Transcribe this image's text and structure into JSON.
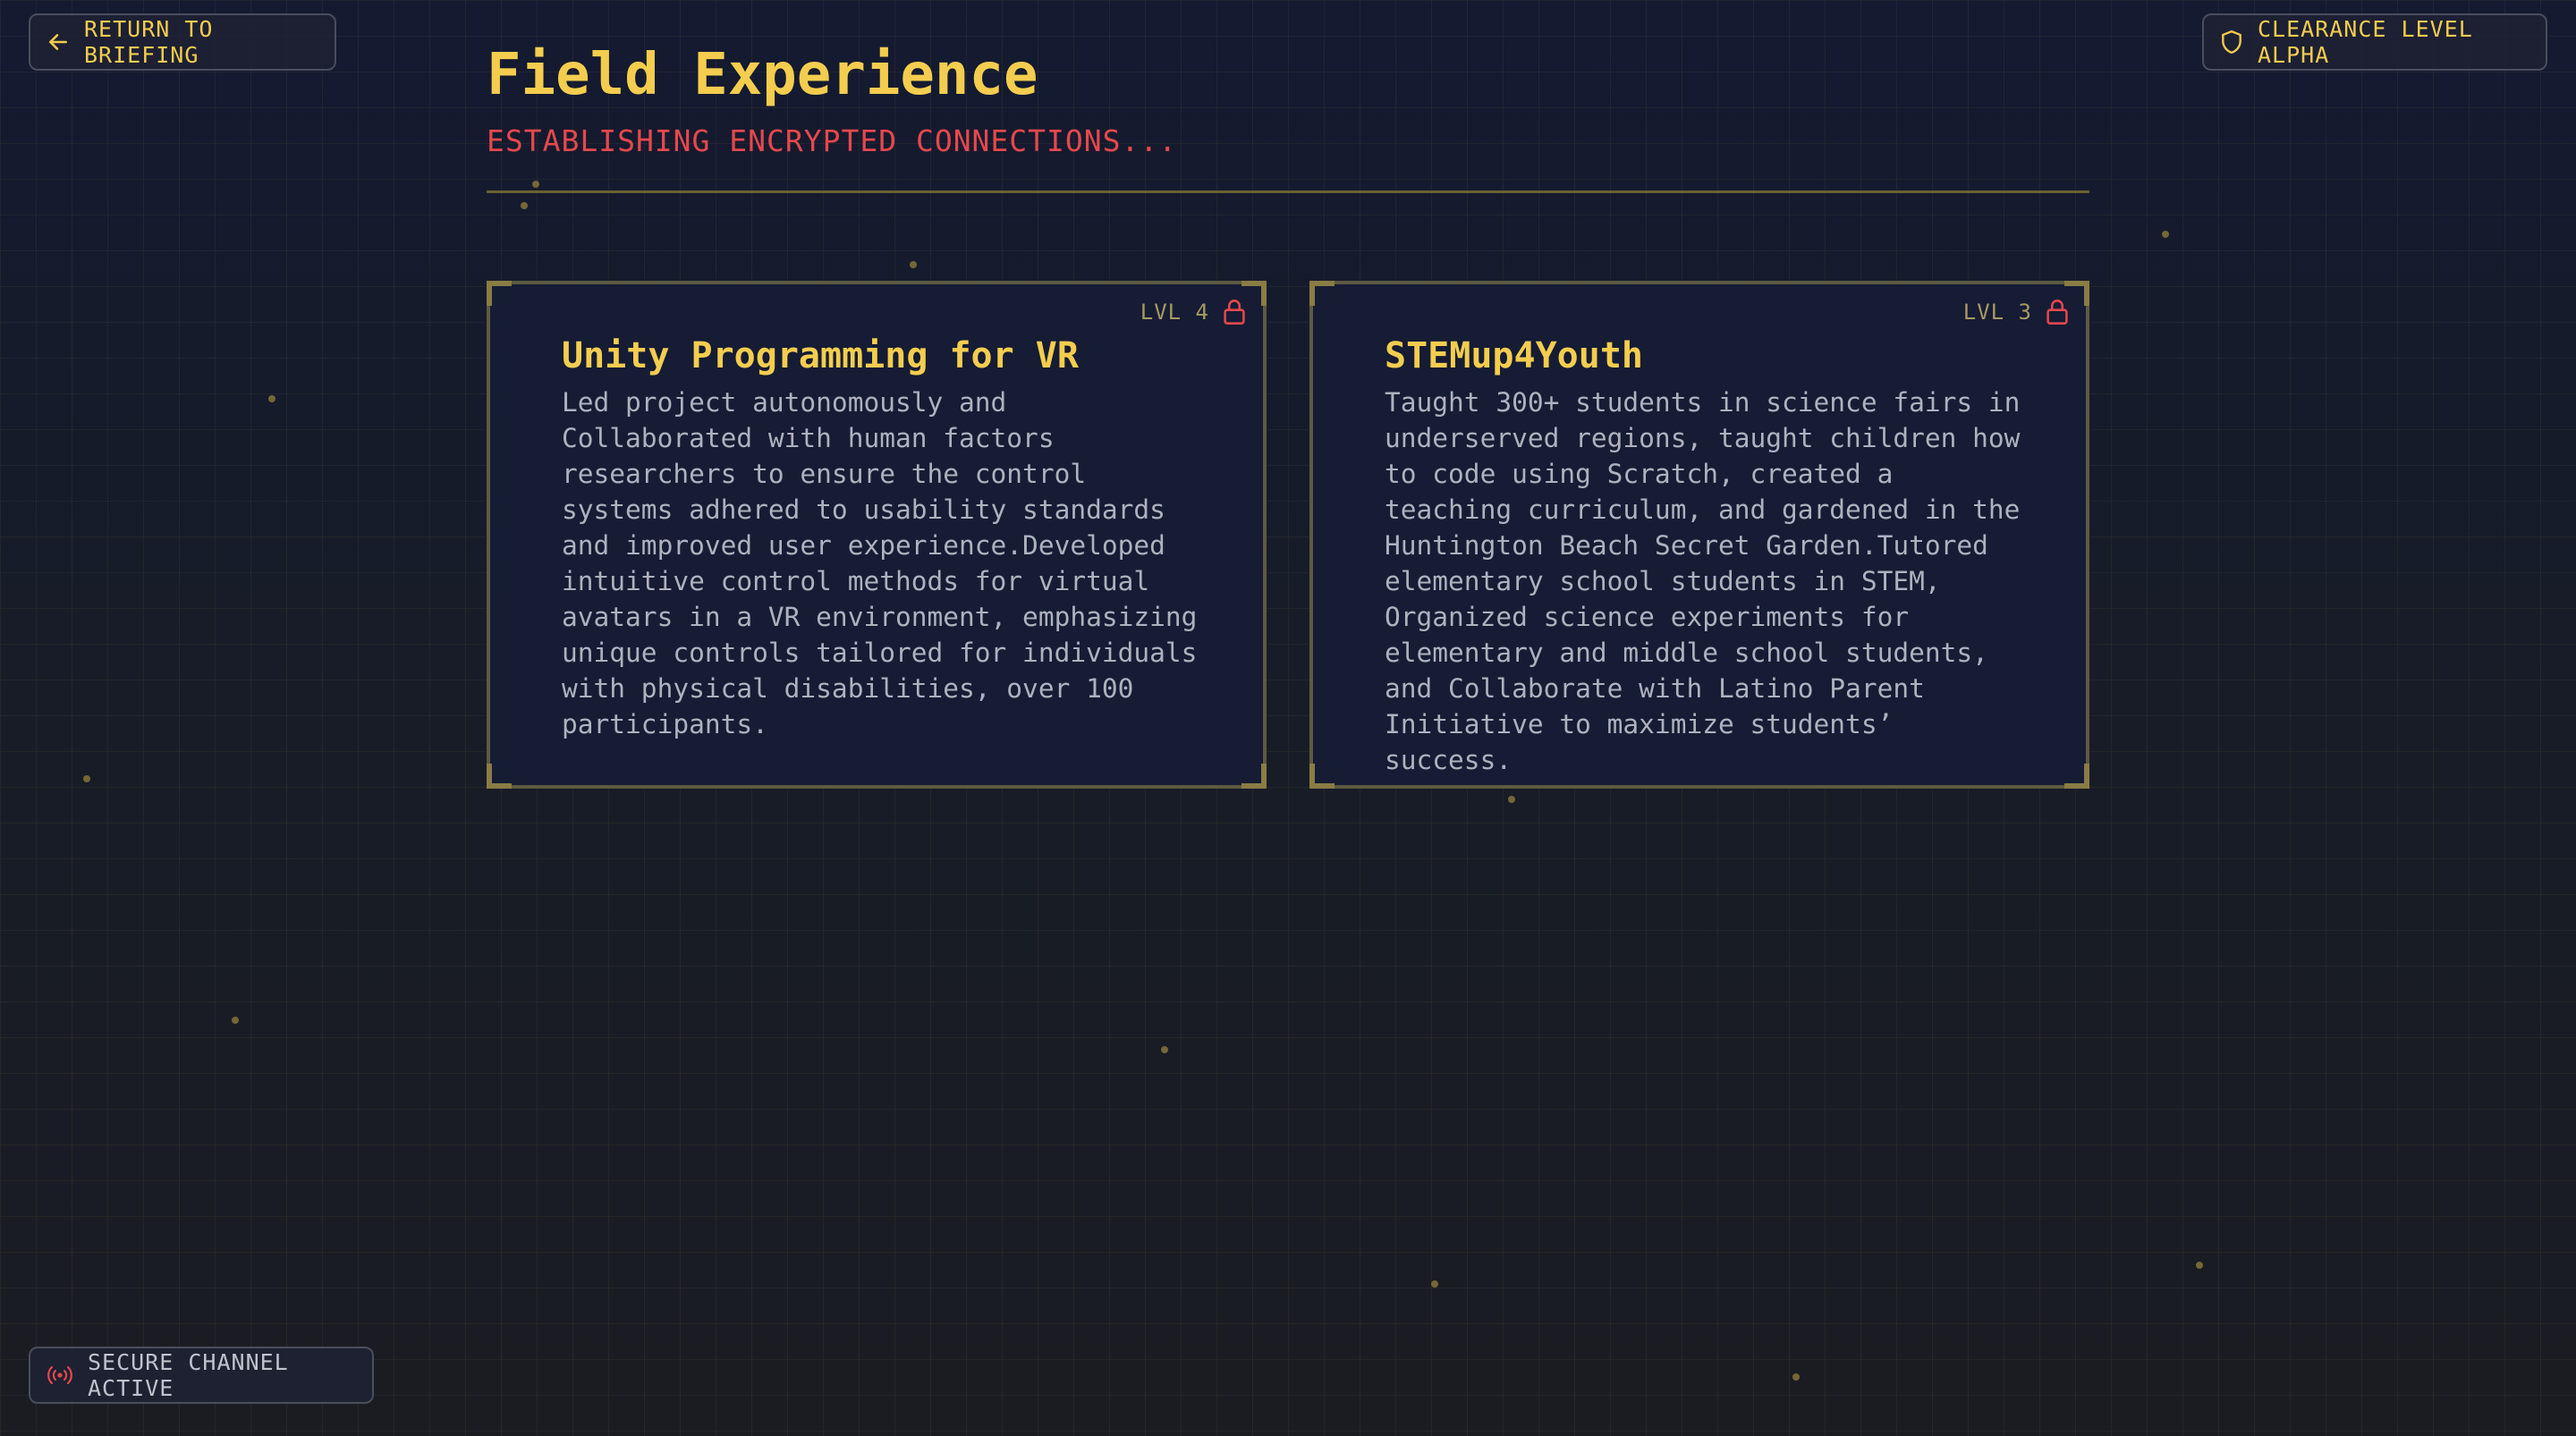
{
  "nav": {
    "return_label": "RETURN TO BRIEFING",
    "return_icon": "arrow-left-icon",
    "clearance_label": "CLEARANCE LEVEL ALPHA",
    "clearance_icon": "shield-icon"
  },
  "header": {
    "title": "Field Experience",
    "status": "ESTABLISHING ENCRYPTED CONNECTIONS..."
  },
  "cards": [
    {
      "level": "LVL 4",
      "lock_icon": "lock-icon",
      "title": "Unity Programming for VR",
      "description": "Led project autonomously and Collaborated with human factors researchers to ensure the control systems adhered to usability standards and improved user experience.Developed intuitive control methods for virtual avatars in a VR environment, emphasizing unique controls tailored for individuals with physical disabilities, over 100 participants."
    },
    {
      "level": "LVL 3",
      "lock_icon": "lock-icon",
      "title": "STEMup4Youth",
      "description": "Taught 300+ students in science fairs in underserved regions, taught children how to code using Scratch, created a teaching curriculum, and gardened in the Huntington Beach Secret Garden.Tutored elementary school students in STEM, Organized science experiments for elementary and middle school students, and Collaborate with Latino Parent Initiative to maximize students’ success."
    }
  ],
  "footer": {
    "secure_label": "SECURE CHANNEL ACTIVE",
    "secure_icon": "radio-signal-icon"
  },
  "colors": {
    "accent": "#f4cd4f",
    "alert": "#e5484d",
    "background": "#15192a",
    "card_background": "#151c34"
  }
}
